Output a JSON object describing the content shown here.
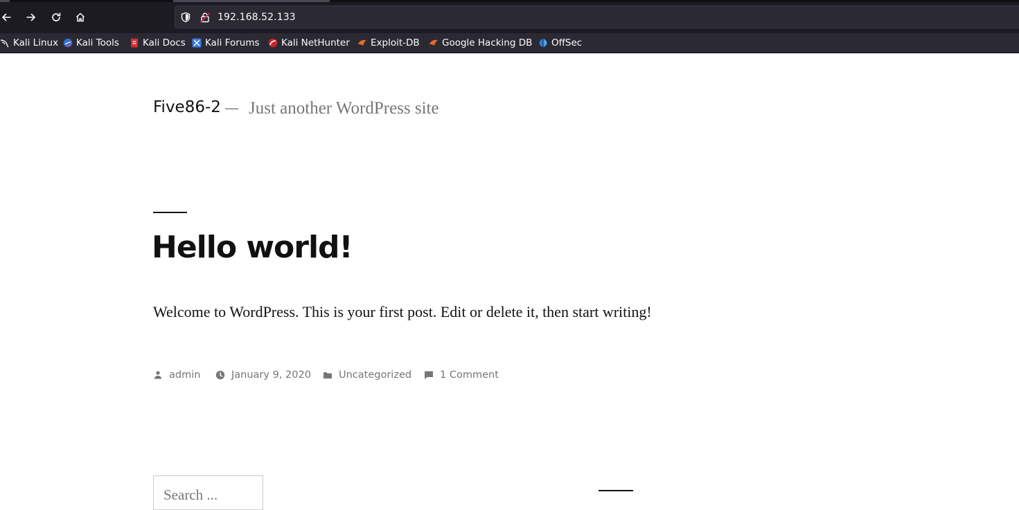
{
  "browser": {
    "url": "192.168.52.133",
    "bookmarks": [
      {
        "label": "Kali Linux",
        "icon": "kali-dragon-icon"
      },
      {
        "label": "Kali Tools",
        "icon": "kali-tools-icon"
      },
      {
        "label": "Kali Docs",
        "icon": "kali-docs-icon"
      },
      {
        "label": "Kali Forums",
        "icon": "kali-forums-icon"
      },
      {
        "label": "Kali NetHunter",
        "icon": "kali-nethunter-icon"
      },
      {
        "label": "Exploit-DB",
        "icon": "exploit-db-icon"
      },
      {
        "label": "Google Hacking DB",
        "icon": "ghdb-icon"
      },
      {
        "label": "OffSec",
        "icon": "offsec-icon"
      }
    ]
  },
  "site": {
    "title": "Five86-2",
    "separator": "—",
    "description": "Just another WordPress site"
  },
  "post": {
    "title": "Hello world!",
    "body": "Welcome to WordPress. This is your first post. Edit or delete it, then start writing!",
    "author": "admin",
    "date": "January 9, 2020",
    "category": "Uncategorized",
    "comments": "1 Comment"
  },
  "search": {
    "placeholder": "Search ..."
  },
  "colors": {
    "chrome_bg": "#1c1b22",
    "bookmarks_bg": "#2b2a33",
    "text_dark": "#111111",
    "text_muted": "#767676"
  }
}
